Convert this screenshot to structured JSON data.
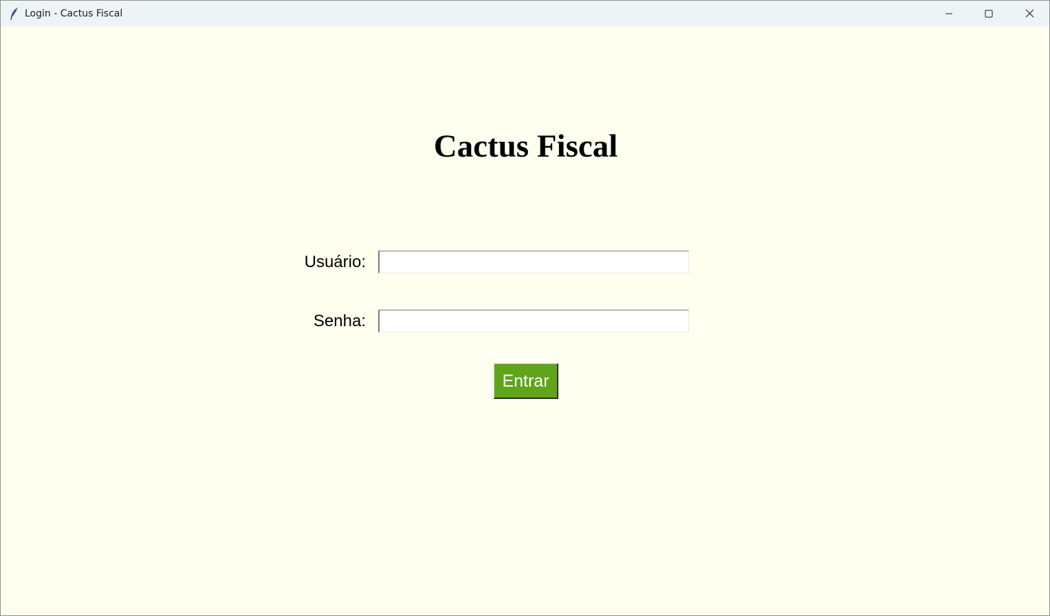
{
  "window": {
    "title": "Login - Cactus Fiscal",
    "icon": "feather-icon",
    "controls": [
      "minimize-icon",
      "maximize-icon",
      "close-icon"
    ]
  },
  "colors": {
    "background": "#fffff0",
    "titlebar": "#eef4f5",
    "button": "#5fa41a",
    "button_text": "#ffffff"
  },
  "heading": "Cactus Fiscal",
  "form": {
    "user_label": "Usuário:",
    "user_value": "",
    "password_label": "Senha:",
    "password_value": "",
    "submit_label": "Entrar"
  }
}
